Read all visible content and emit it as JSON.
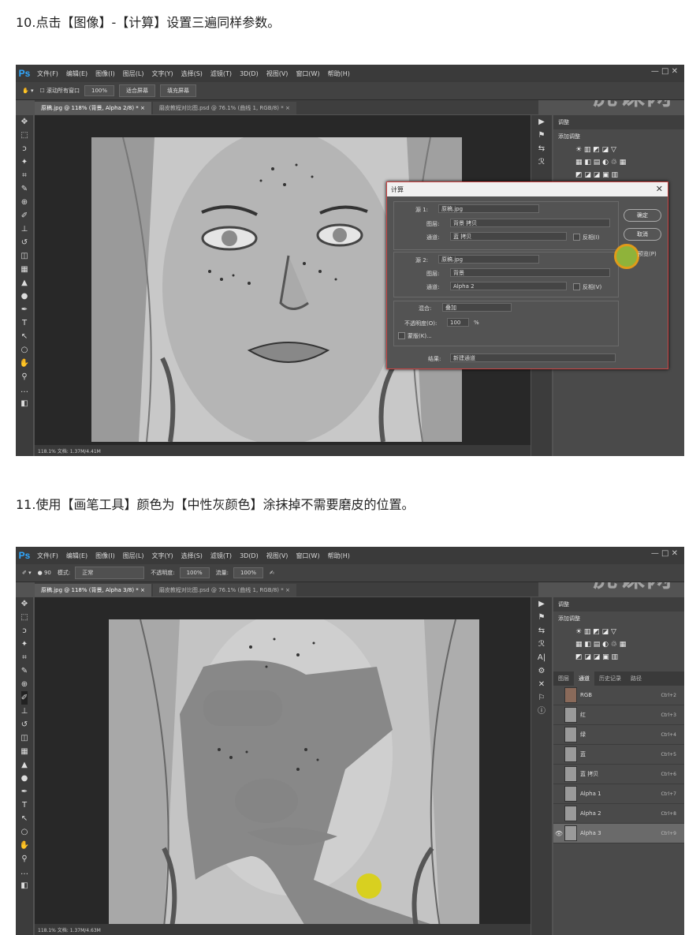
{
  "step1": {
    "text": "10.点击【图像】-【计算】设置三遍同样参数。"
  },
  "step2": {
    "text": "11.使用【画笔工具】颜色为【中性灰颜色】涂抹掉不需要磨皮的位置。"
  },
  "app": {
    "logo": "Ps",
    "menu": [
      "文件(F)",
      "编辑(E)",
      "图像(I)",
      "图层(L)",
      "文字(Y)",
      "选择(S)",
      "滤镜(T)",
      "3D(D)",
      "视图(V)",
      "窗口(W)",
      "帮助(H)"
    ],
    "watermark": "虎课网",
    "window_controls": "— □ ✕"
  },
  "shot1": {
    "options": {
      "scroll_all": "滚动所有窗口",
      "zoom": "100%",
      "fit": "适合屏幕",
      "fill": "填充屏幕"
    },
    "tabs": [
      "原稿.jpg @ 118% (背景, Alpha 2/8) *  ×",
      "磨皮教程对比图.psd @ 76.1% (曲线 1, RGB/8) *  ×"
    ],
    "status": "118.1%      文档: 1.37M/4.41M",
    "panel_title": "调整",
    "panel_subtitle": "添加调整",
    "icons_row1": "☀ ▥ ◩ ◪ ▽",
    "icons_row2": "▦ ◧ ▤ ◐ ♲ ▦",
    "icons_row3": "◩ ◪ ◪ ▣ ▥",
    "dialog": {
      "title": "计算",
      "close": "✕",
      "source1_label": "源 1:",
      "source1_value": "原稿.jpg",
      "layer_label": "图层:",
      "layer1_value": "背景 拷贝",
      "channel_label": "通道:",
      "channel1_value": "蓝 拷贝",
      "invert_label": "反相(I)",
      "source2_label": "源 2:",
      "source2_value": "原稿.jpg",
      "layer2_value": "背景",
      "channel2_value": "Alpha 2",
      "invert2_label": "反相(V)",
      "blend_label": "混合:",
      "blend_value": "叠加",
      "opacity_label": "不透明度(O):",
      "opacity_value": "100",
      "opacity_unit": "%",
      "mask_label": "蒙版(K)...",
      "result_label": "结果:",
      "result_value": "新建通道",
      "ok": "确定",
      "cancel": "取消",
      "preview": "预览(P)"
    }
  },
  "shot2": {
    "options": {
      "mode_label": "模式:",
      "mode_value": "正常",
      "opacity_label": "不透明度:",
      "opacity_value": "100%",
      "flow_label": "流量:",
      "flow_value": "100%",
      "brush_size": "90"
    },
    "tabs": [
      "原稿.jpg @ 118% (背景, Alpha 3/8) *  ×",
      "磨皮教程对比图.psd @ 76.1% (曲线 1, RGB/8) *  ×"
    ],
    "status": "118.1%      文档: 1.37M/4.63M",
    "panel_title": "调整",
    "panel_subtitle": "添加调整",
    "icons_row1": "☀ ▥ ◩ ◪ ▽",
    "icons_row2": "▦ ◧ ▤ ◐ ♲ ▦",
    "icons_row3": "◩ ◪ ◪ ▣ ▥",
    "panel_tabs": [
      "图层",
      "通道",
      "历史记录",
      "路径"
    ],
    "channels": [
      {
        "name": "RGB",
        "key": "Ctrl+2"
      },
      {
        "name": "红",
        "key": "Ctrl+3"
      },
      {
        "name": "绿",
        "key": "Ctrl+4"
      },
      {
        "name": "蓝",
        "key": "Ctrl+5"
      },
      {
        "name": "蓝 拷贝",
        "key": "Ctrl+6"
      },
      {
        "name": "Alpha 1",
        "key": "Ctrl+7"
      },
      {
        "name": "Alpha 2",
        "key": "Ctrl+8"
      },
      {
        "name": "Alpha 3",
        "key": "Ctrl+9"
      }
    ]
  },
  "colors": {
    "ps_dark": "#3a3a3a",
    "ps_panel": "#4a4a4a",
    "highlight_orange": "#e09b1a",
    "highlight_yellow": "#d8d020"
  }
}
